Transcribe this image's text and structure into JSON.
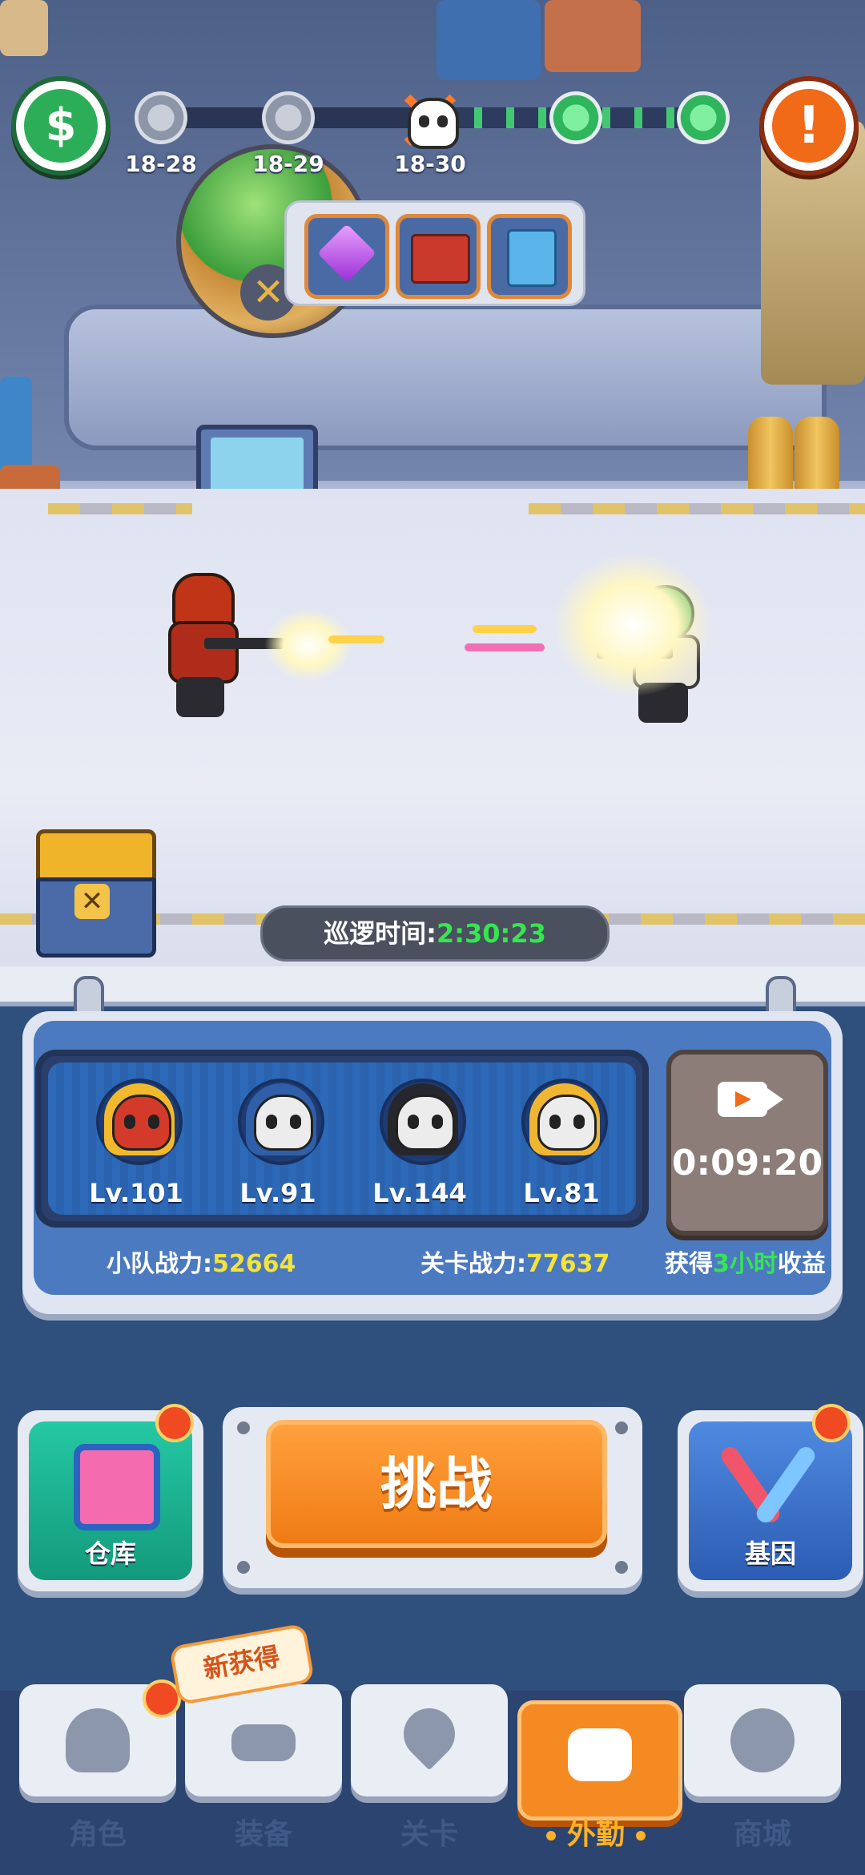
{
  "hud": {
    "stages": [
      {
        "label": "18-28",
        "state": "cleared"
      },
      {
        "label": "18-29",
        "state": "cleared"
      },
      {
        "label": "18-30",
        "state": "current-boss"
      }
    ],
    "upcoming_nodes": 2,
    "rewards": [
      "purple-gem",
      "weapon-blueprint",
      "document-card"
    ]
  },
  "scene": {
    "patrol_label": "巡逻时间:",
    "patrol_time": "2:30:23"
  },
  "squad": {
    "members": [
      {
        "level": "Lv.101",
        "avatar": "red-bee-skull"
      },
      {
        "level": "Lv.91",
        "avatar": "blue-helmet-skull"
      },
      {
        "level": "Lv.144",
        "avatar": "black-hood-skull"
      },
      {
        "level": "Lv.81",
        "avatar": "straw-hat-skull"
      }
    ],
    "video_timer": "0:09:20",
    "team_power_label": "小队战力:",
    "team_power": "52664",
    "stage_power_label": "关卡战力:",
    "stage_power": "77637",
    "earn_prefix": "获得",
    "earn_hours": "3小时",
    "earn_suffix": "收益"
  },
  "actions": {
    "warehouse": "仓库",
    "challenge": "挑战",
    "gene": "基因"
  },
  "nav": {
    "new_badge": "新获得",
    "tabs": [
      {
        "label": "角色",
        "active": false
      },
      {
        "label": "装备",
        "active": false
      },
      {
        "label": "关卡",
        "active": false
      },
      {
        "label": "外勤",
        "active": true
      },
      {
        "label": "商城",
        "active": false
      }
    ]
  },
  "colors": {
    "accent_orange": "#f07b14",
    "highlight_green": "#35e650",
    "highlight_yellow": "#f3e33a",
    "panel_blue": "#4b7ac0"
  }
}
